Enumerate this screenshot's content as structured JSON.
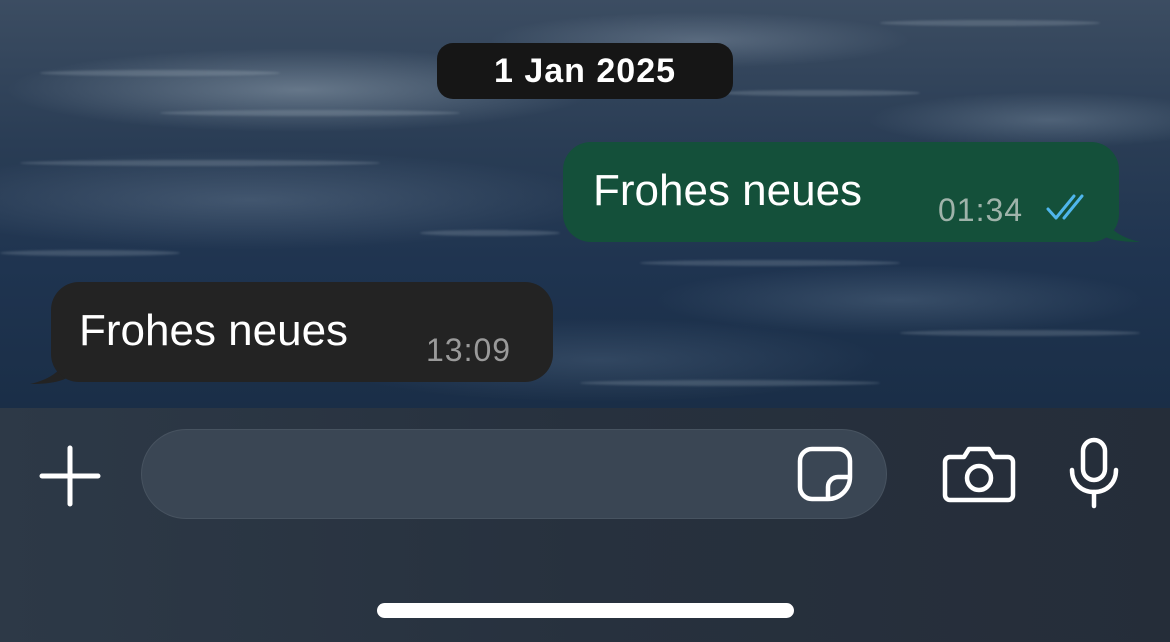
{
  "date_chip": "1 Jan 2025",
  "messages": [
    {
      "direction": "outgoing",
      "text": "Frohes neues",
      "time": "01:34",
      "status": "read"
    },
    {
      "direction": "incoming",
      "text": "Frohes neues",
      "time": "13:09"
    }
  ],
  "composer": {
    "placeholder": "",
    "icons": [
      "plus-icon",
      "sticker-icon",
      "camera-icon",
      "microphone-icon"
    ]
  },
  "colors": {
    "outgoing_bubble": "#14503a",
    "incoming_bubble": "#232323",
    "read_ticks": "#4fb6ec",
    "date_chip_bg": "#161616"
  }
}
